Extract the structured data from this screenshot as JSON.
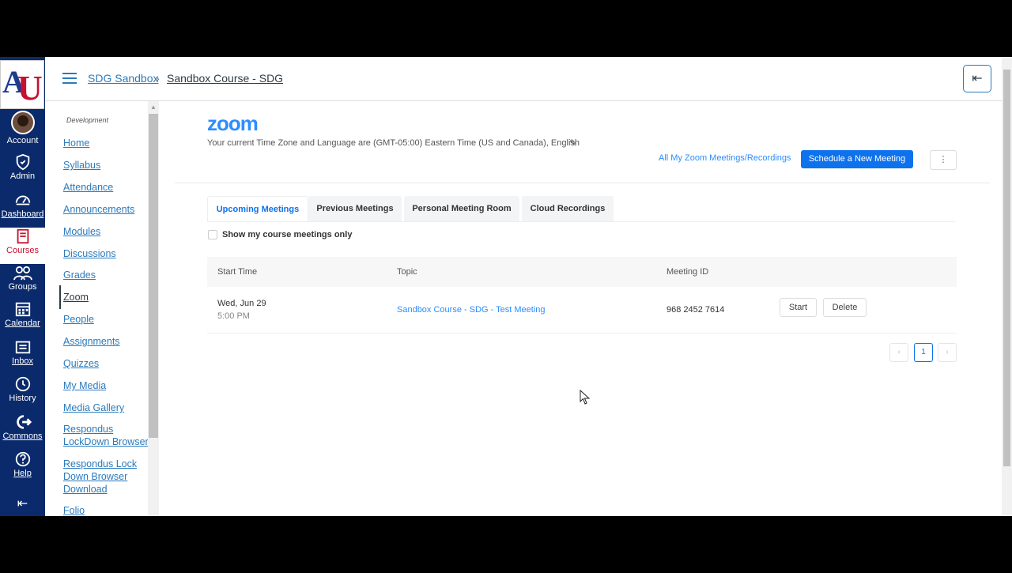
{
  "global_nav": {
    "items": [
      {
        "label": "Account",
        "icon": "avatar"
      },
      {
        "label": "Admin",
        "icon": "shield-icon"
      },
      {
        "label": "Dashboard",
        "icon": "dashboard-icon"
      },
      {
        "label": "Courses",
        "icon": "book-icon"
      },
      {
        "label": "Groups",
        "icon": "groups-icon"
      },
      {
        "label": "Calendar",
        "icon": "calendar-icon"
      },
      {
        "label": "Inbox",
        "icon": "inbox-icon"
      },
      {
        "label": "History",
        "icon": "clock-icon"
      },
      {
        "label": "Commons",
        "icon": "commons-icon"
      },
      {
        "label": "Help",
        "icon": "help-icon"
      }
    ],
    "active_color": "#c8102e",
    "bg_color": "#0a2a6b"
  },
  "header": {
    "breadcrumb_1": "SDG Sandbox",
    "breadcrumb_sep": "›",
    "breadcrumb_2": "Sandbox Course - SDG",
    "collapse_icon": "⇤"
  },
  "course_nav": {
    "subtitle": "Development",
    "items": [
      {
        "label": "Home"
      },
      {
        "label": "Syllabus"
      },
      {
        "label": "Attendance"
      },
      {
        "label": "Announcements"
      },
      {
        "label": "Modules"
      },
      {
        "label": "Discussions"
      },
      {
        "label": "Grades"
      },
      {
        "label": "Zoom"
      },
      {
        "label": "People"
      },
      {
        "label": "Assignments"
      },
      {
        "label": "Quizzes"
      },
      {
        "label": "My Media"
      },
      {
        "label": "Media Gallery"
      },
      {
        "label": "Respondus LockDown Browser"
      },
      {
        "label": "Respondus Lock Down Browser Download"
      },
      {
        "label": "Folio"
      }
    ],
    "selected": "Zoom"
  },
  "zoom": {
    "logo": "zoom",
    "timezone_text": "Your current Time Zone and Language are (GMT-05:00) Eastern Time (US and Canada), English",
    "all_meetings_link": "All My Zoom Meetings/Recordings",
    "schedule_button": "Schedule a New Meeting",
    "more_button": "⋮",
    "tabs": [
      "Upcoming Meetings",
      "Previous Meetings",
      "Personal Meeting Room",
      "Cloud Recordings"
    ],
    "active_tab": "Upcoming Meetings",
    "checkbox_label": "Show my course meetings only",
    "table": {
      "headers": [
        "Start Time",
        "Topic",
        "Meeting ID"
      ],
      "rows": [
        {
          "date": "Wed, Jun 29",
          "time": "5:00 PM",
          "topic": "Sandbox Course - SDG - Test Meeting",
          "meeting_id": "968 2452 7614",
          "start_label": "Start",
          "delete_label": "Delete"
        }
      ]
    },
    "pagination": {
      "prev": "‹",
      "current": "1",
      "next": "›"
    },
    "accent_color": "#0e72ed"
  }
}
